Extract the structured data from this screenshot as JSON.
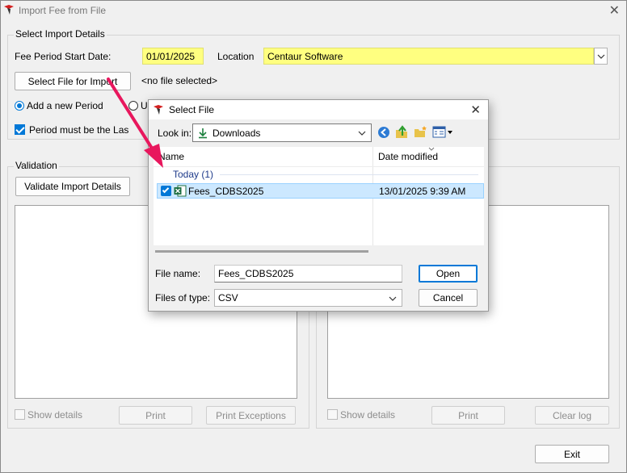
{
  "window": {
    "title": "Import Fee from File",
    "close_glyph": "✕",
    "app_icon": "centaur-logo-icon"
  },
  "import_details": {
    "legend": "Select Import Details",
    "fee_period_label": "Fee Period Start Date:",
    "fee_period_value": "01/01/2025",
    "location_label": "Location",
    "location_value": "Centaur Software",
    "select_file_button": "Select File for Import",
    "no_file_text": "<no file selected>",
    "radio_add_label": "Add a new Period",
    "radio_update_label": "U",
    "period_last_label": "Period must be the Las"
  },
  "validation": {
    "legend": "Validation",
    "validate_button": "Validate Import Details",
    "show_details_left": "Show details",
    "print_left": "Print",
    "print_exceptions": "Print Exceptions",
    "show_details_right": "Show details",
    "print_right": "Print",
    "clear_log": "Clear log"
  },
  "footer": {
    "exit_button": "Exit"
  },
  "dialog": {
    "title": "Select File",
    "close_glyph": "✕",
    "look_in_label": "Look in:",
    "look_in_value": "Downloads",
    "col_name": "Name",
    "col_date": "Date modified",
    "group_label": "Today (1)",
    "file": {
      "name": "Fees_CDBS2025",
      "date": "13/01/2025 9:39 AM"
    },
    "file_name_label": "File name:",
    "file_name_value": "Fees_CDBS2025",
    "files_of_type_label": "Files of type:",
    "files_of_type_value": "CSV",
    "open_button": "Open",
    "cancel_button": "Cancel"
  },
  "colors": {
    "accent": "#0078d7",
    "highlight_field": "#ffff80",
    "annotation_arrow": "#e8175d",
    "selection": "#cce8ff"
  }
}
